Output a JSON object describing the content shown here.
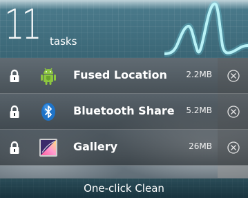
{
  "header": {
    "task_count": "11",
    "task_count_label": "tasks"
  },
  "tasks": [
    {
      "name": "Fused Location",
      "size": "2.2MB",
      "icon": "android-icon",
      "locked": true
    },
    {
      "name": "Bluetooth Share",
      "size": "5.2MB",
      "icon": "bluetooth-icon",
      "locked": true
    },
    {
      "name": "Gallery",
      "size": "26MB",
      "icon": "gallery-icon",
      "locked": true
    }
  ],
  "footer": {
    "clean_label": "One-click Clean"
  },
  "colors": {
    "android_green": "#8cc63f",
    "bluetooth_blue": "#1e73c8",
    "header_teal": "#4f7f8f",
    "pulse_cyan": "#d8ffff"
  }
}
